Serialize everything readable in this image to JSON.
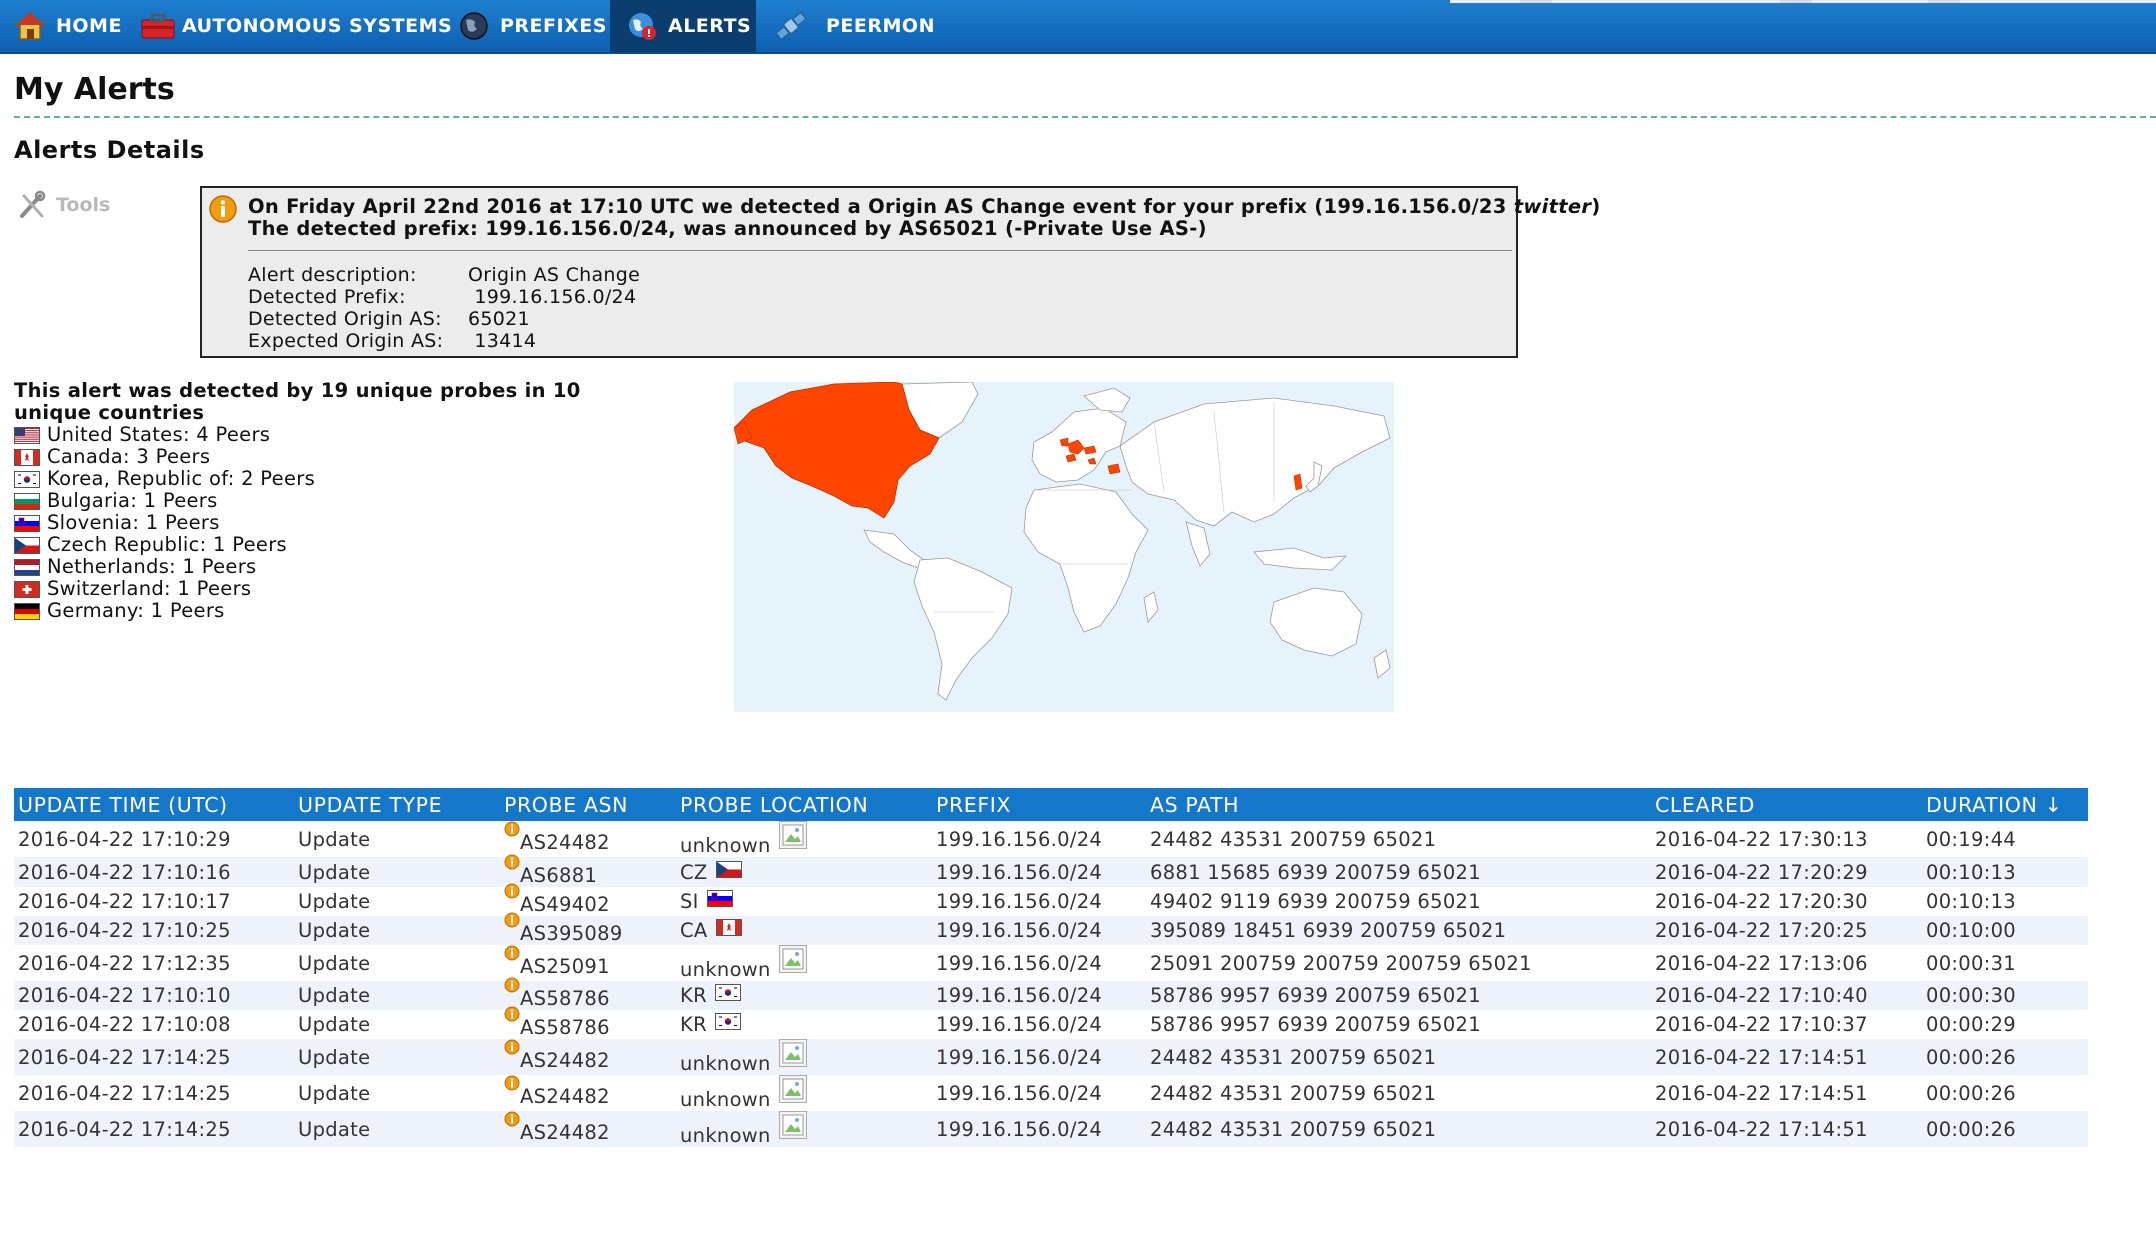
{
  "nav": {
    "items": [
      {
        "label": "HOME",
        "icon": "house-icon"
      },
      {
        "label": "AUTONOMOUS SYSTEMS",
        "icon": "toolbox-icon"
      },
      {
        "label": "PREFIXES",
        "icon": "globe-icon"
      },
      {
        "label": "ALERTS",
        "icon": "alert-globe-icon",
        "active": true
      },
      {
        "label": "PEERMON",
        "icon": "satellite-icon"
      }
    ]
  },
  "page": {
    "title": "My Alerts",
    "section_title": "Alerts Details",
    "tools_label": "Tools"
  },
  "alert": {
    "headline_line1_pre": "On Friday April 22nd 2016 at 17:10 UTC we detected a Origin AS Change event for your prefix (199.16.156.0/23 ",
    "headline_line1_em": "twitter",
    "headline_line1_post": ")",
    "headline_line2": "The detected prefix: 199.16.156.0/24, was announced by AS65021 (-Private Use AS-)",
    "details": [
      {
        "label": "Alert description:",
        "value": "Origin AS Change"
      },
      {
        "label": "Detected Prefix:",
        "value": " 199.16.156.0/24"
      },
      {
        "label": "Detected Origin AS:",
        "value": "65021"
      },
      {
        "label": "Expected Origin AS:",
        "value": " 13414"
      }
    ]
  },
  "probes": {
    "summary": "This alert was detected by 19 unique probes in 10 unique countries",
    "countries": [
      {
        "text": "United States: 4 Peers",
        "flag": "us"
      },
      {
        "text": "Canada: 3 Peers",
        "flag": "ca"
      },
      {
        "text": "Korea, Republic of: 2 Peers",
        "flag": "kr"
      },
      {
        "text": "Bulgaria: 1 Peers",
        "flag": "bg"
      },
      {
        "text": "Slovenia: 1 Peers",
        "flag": "si"
      },
      {
        "text": "Czech Republic: 1 Peers",
        "flag": "cz"
      },
      {
        "text": "Netherlands: 1 Peers",
        "flag": "nl"
      },
      {
        "text": "Switzerland: 1 Peers",
        "flag": "ch"
      },
      {
        "text": "Germany: 1 Peers",
        "flag": "de"
      }
    ]
  },
  "map": {
    "highlight_color": "#ff4500",
    "land_color": "#ffffff",
    "water_color": "#e6f3fb"
  },
  "table": {
    "columns": [
      "UPDATE TIME (UTC)",
      "UPDATE TYPE",
      "PROBE ASN",
      "PROBE LOCATION",
      "PREFIX",
      "AS PATH",
      "CLEARED",
      "DURATION ↓"
    ],
    "rows": [
      {
        "time": "2016-04-22 17:10:29",
        "type": "Update",
        "asn": "AS24482",
        "loc": "unknown",
        "flag": "",
        "prefix": "199.16.156.0/24",
        "path": "24482 43531 200759 65021",
        "cleared": "2016-04-22 17:30:13",
        "duration": "00:19:44"
      },
      {
        "time": "2016-04-22 17:10:16",
        "type": "Update",
        "asn": "AS6881",
        "loc": "CZ",
        "flag": "cz",
        "prefix": "199.16.156.0/24",
        "path": "6881 15685 6939 200759 65021",
        "cleared": "2016-04-22 17:20:29",
        "duration": "00:10:13"
      },
      {
        "time": "2016-04-22 17:10:17",
        "type": "Update",
        "asn": "AS49402",
        "loc": "SI",
        "flag": "si",
        "prefix": "199.16.156.0/24",
        "path": "49402 9119 6939 200759 65021",
        "cleared": "2016-04-22 17:20:30",
        "duration": "00:10:13"
      },
      {
        "time": "2016-04-22 17:10:25",
        "type": "Update",
        "asn": "AS395089",
        "loc": "CA",
        "flag": "ca",
        "prefix": "199.16.156.0/24",
        "path": "395089 18451 6939 200759 65021",
        "cleared": "2016-04-22 17:20:25",
        "duration": "00:10:00"
      },
      {
        "time": "2016-04-22 17:12:35",
        "type": "Update",
        "asn": "AS25091",
        "loc": "unknown",
        "flag": "",
        "prefix": "199.16.156.0/24",
        "path": "25091 200759 200759 200759 65021",
        "cleared": "2016-04-22 17:13:06",
        "duration": "00:00:31"
      },
      {
        "time": "2016-04-22 17:10:10",
        "type": "Update",
        "asn": "AS58786",
        "loc": "KR",
        "flag": "kr",
        "prefix": "199.16.156.0/24",
        "path": "58786 9957 6939 200759 65021",
        "cleared": "2016-04-22 17:10:40",
        "duration": "00:00:30"
      },
      {
        "time": "2016-04-22 17:10:08",
        "type": "Update",
        "asn": "AS58786",
        "loc": "KR",
        "flag": "kr",
        "prefix": "199.16.156.0/24",
        "path": "58786 9957 6939 200759 65021",
        "cleared": "2016-04-22 17:10:37",
        "duration": "00:00:29"
      },
      {
        "time": "2016-04-22 17:14:25",
        "type": "Update",
        "asn": "AS24482",
        "loc": "unknown",
        "flag": "",
        "prefix": "199.16.156.0/24",
        "path": "24482 43531 200759 65021",
        "cleared": "2016-04-22 17:14:51",
        "duration": "00:00:26"
      },
      {
        "time": "2016-04-22 17:14:25",
        "type": "Update",
        "asn": "AS24482",
        "loc": "unknown",
        "flag": "",
        "prefix": "199.16.156.0/24",
        "path": "24482 43531 200759 65021",
        "cleared": "2016-04-22 17:14:51",
        "duration": "00:00:26"
      },
      {
        "time": "2016-04-22 17:14:25",
        "type": "Update",
        "asn": "AS24482",
        "loc": "unknown",
        "flag": "",
        "prefix": "199.16.156.0/24",
        "path": "24482 43531 200759 65021",
        "cleared": "2016-04-22 17:14:51",
        "duration": "00:00:26"
      }
    ]
  }
}
